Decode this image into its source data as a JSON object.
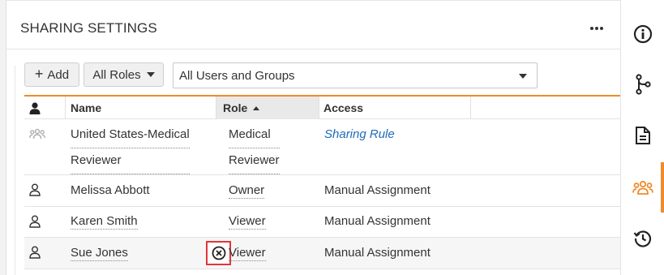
{
  "panel": {
    "title": "SHARING SETTINGS",
    "more_icon": "more-horizontal-icon"
  },
  "toolbar": {
    "add_label": "Add",
    "roles_label": "All Roles",
    "users_filter_value": "All Users and Groups"
  },
  "table": {
    "columns": {
      "icon": "person-icon",
      "name": "Name",
      "role": "Role",
      "access": "Access"
    },
    "sort": {
      "column": "Role",
      "direction": "ascending"
    },
    "rows": [
      {
        "icon": "group-icon",
        "name_line1": "United States-Medical",
        "name_line2": "Reviewer",
        "role_line1": "Medical",
        "role_line2": "Reviewer",
        "access": "Sharing Rule"
      },
      {
        "icon": "user-icon",
        "name": "Melissa Abbott",
        "role": "Owner",
        "access": "Manual Assignment"
      },
      {
        "icon": "user-icon",
        "name": "Karen Smith",
        "role": "Viewer",
        "access": "Manual Assignment"
      },
      {
        "icon": "user-icon",
        "name": "Sue Jones",
        "role": "Viewer",
        "access": "Manual Assignment",
        "hover_action": "remove-circle-icon"
      }
    ]
  },
  "rail": {
    "items": [
      {
        "icon": "info-circle-icon"
      },
      {
        "icon": "branch-icon"
      },
      {
        "icon": "document-icon"
      },
      {
        "icon": "sharing-users-icon",
        "active": true
      },
      {
        "icon": "history-icon"
      }
    ]
  },
  "colors": {
    "accent": "#ef8b2a",
    "link": "#1e6bb8",
    "remove_highlight": "#e2353b"
  }
}
